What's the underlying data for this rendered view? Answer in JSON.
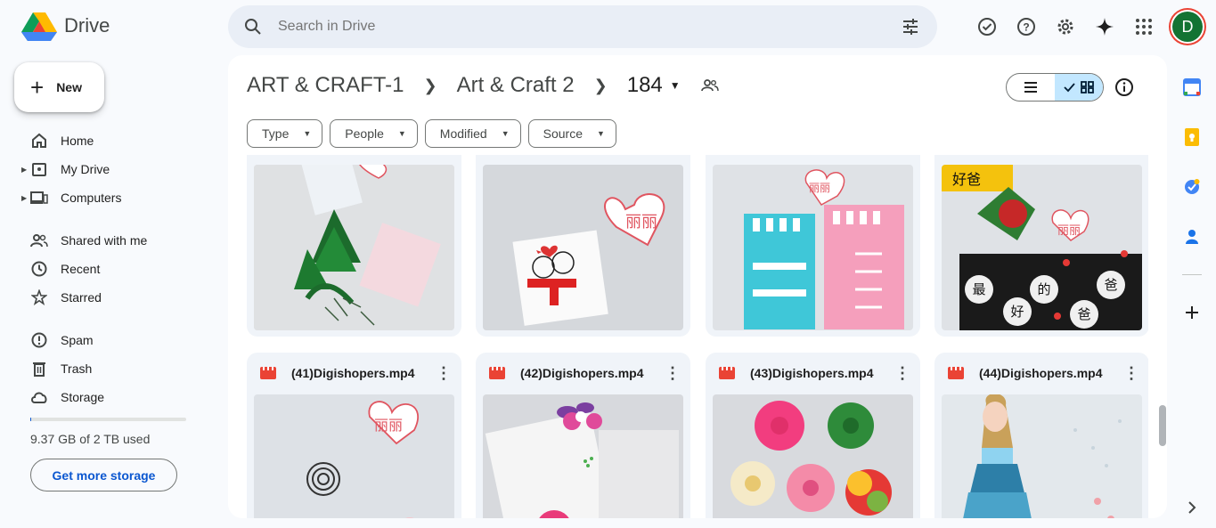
{
  "app": {
    "name": "Drive"
  },
  "search": {
    "placeholder": "Search in Drive"
  },
  "account": {
    "initial": "D"
  },
  "sidebar": {
    "new_label": "New",
    "items": [
      {
        "label": "Home"
      },
      {
        "label": "My Drive"
      },
      {
        "label": "Computers"
      },
      {
        "label": "Shared with me"
      },
      {
        "label": "Recent"
      },
      {
        "label": "Starred"
      },
      {
        "label": "Spam"
      },
      {
        "label": "Trash"
      },
      {
        "label": "Storage"
      }
    ],
    "storage_used_text": "9.37 GB of 2 TB used",
    "storage_fraction": 0.005,
    "get_more_label": "Get more storage"
  },
  "breadcrumb": [
    "ART & CRAFT-1",
    "Art & Craft 2",
    "184"
  ],
  "filters": [
    "Type",
    "People",
    "Modified",
    "Source"
  ],
  "files": [
    {
      "name": "(41)Digishopers.mp4"
    },
    {
      "name": "(42)Digishopers.mp4"
    },
    {
      "name": "(43)Digishopers.mp4"
    },
    {
      "name": "(44)Digishopers.mp4"
    }
  ],
  "thumb_text": {
    "heart": "丽丽",
    "board": [
      "最",
      "的",
      "爸",
      "好",
      "爸"
    ],
    "sign": "好爸"
  },
  "colors": {
    "accent": "#0b57d0",
    "selected": "#c2e7ff",
    "video": "#ea4335"
  }
}
